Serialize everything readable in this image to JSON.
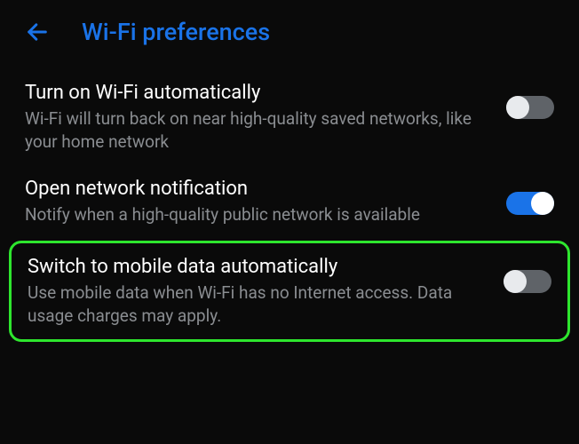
{
  "header": {
    "title": "Wi-Fi preferences"
  },
  "settings": {
    "auto_wifi": {
      "title": "Turn on Wi-Fi automatically",
      "desc": "Wi-Fi will turn back on near high-quality saved networks, like your home network",
      "enabled": false
    },
    "open_network": {
      "title": "Open network notification",
      "desc": "Notify when a high-quality public network is available",
      "enabled": true
    },
    "mobile_data": {
      "title": "Switch to mobile data automatically",
      "desc": "Use mobile data when Wi-Fi has no Internet access. Data usage charges may apply.",
      "enabled": false
    }
  }
}
